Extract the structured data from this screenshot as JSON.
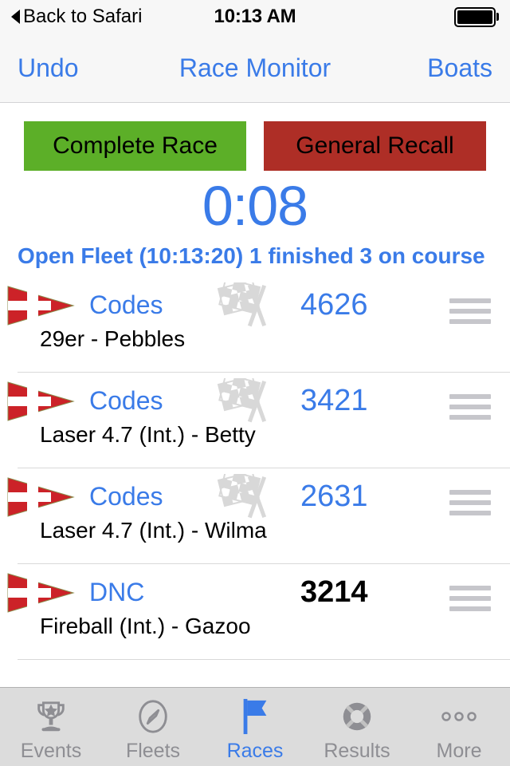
{
  "status_bar": {
    "back_label": "Back to Safari",
    "time": "10:13 AM",
    "battery_icon": "battery-full-icon"
  },
  "nav_bar": {
    "left_label": "Undo",
    "title": "Race Monitor",
    "right_label": "Boats"
  },
  "actions": {
    "complete_race_label": "Complete Race",
    "general_recall_label": "General Recall",
    "complete_race_color": "#5caf28",
    "general_recall_color": "#ae2e26"
  },
  "timer": {
    "value": "0:08",
    "color": "#3a7be8"
  },
  "fleet_status": {
    "text": "Open Fleet (10:13:20) 1 finished 3 on course"
  },
  "boats": [
    {
      "pennant_icon": "numeral-pennant-4-icon",
      "code": "Codes",
      "finish_icon": "checkered-flags-icon",
      "has_finish_icon": true,
      "sail_number": "4626",
      "sail_number_color": "#3a7be8",
      "description": "29er - Pebbles",
      "handle_icon": "reorder-handle-icon"
    },
    {
      "pennant_icon": "numeral-pennant-4-icon",
      "code": "Codes",
      "finish_icon": "checkered-flags-icon",
      "has_finish_icon": true,
      "sail_number": "3421",
      "sail_number_color": "#3a7be8",
      "description": "Laser 4.7 (Int.) - Betty",
      "handle_icon": "reorder-handle-icon"
    },
    {
      "pennant_icon": "numeral-pennant-4-icon",
      "code": "Codes",
      "finish_icon": "checkered-flags-icon",
      "has_finish_icon": true,
      "sail_number": "2631",
      "sail_number_color": "#3a7be8",
      "description": "Laser 4.7 (Int.) - Wilma",
      "handle_icon": "reorder-handle-icon"
    },
    {
      "pennant_icon": "numeral-pennant-4-icon",
      "code": "DNC",
      "finish_icon": "",
      "has_finish_icon": false,
      "sail_number": "3214",
      "sail_number_color": "#000000",
      "description": "Fireball (Int.) - Gazoo",
      "handle_icon": "reorder-handle-icon"
    }
  ],
  "tab_bar": {
    "active_index": 2,
    "active_color": "#3a7be8",
    "inactive_color": "#8e8e93",
    "items": [
      {
        "label": "Events",
        "icon": "trophy-icon"
      },
      {
        "label": "Fleets",
        "icon": "compass-icon"
      },
      {
        "label": "Races",
        "icon": "flag-icon"
      },
      {
        "label": "Results",
        "icon": "life-ring-icon"
      },
      {
        "label": "More",
        "icon": "ellipsis-icon"
      }
    ]
  }
}
